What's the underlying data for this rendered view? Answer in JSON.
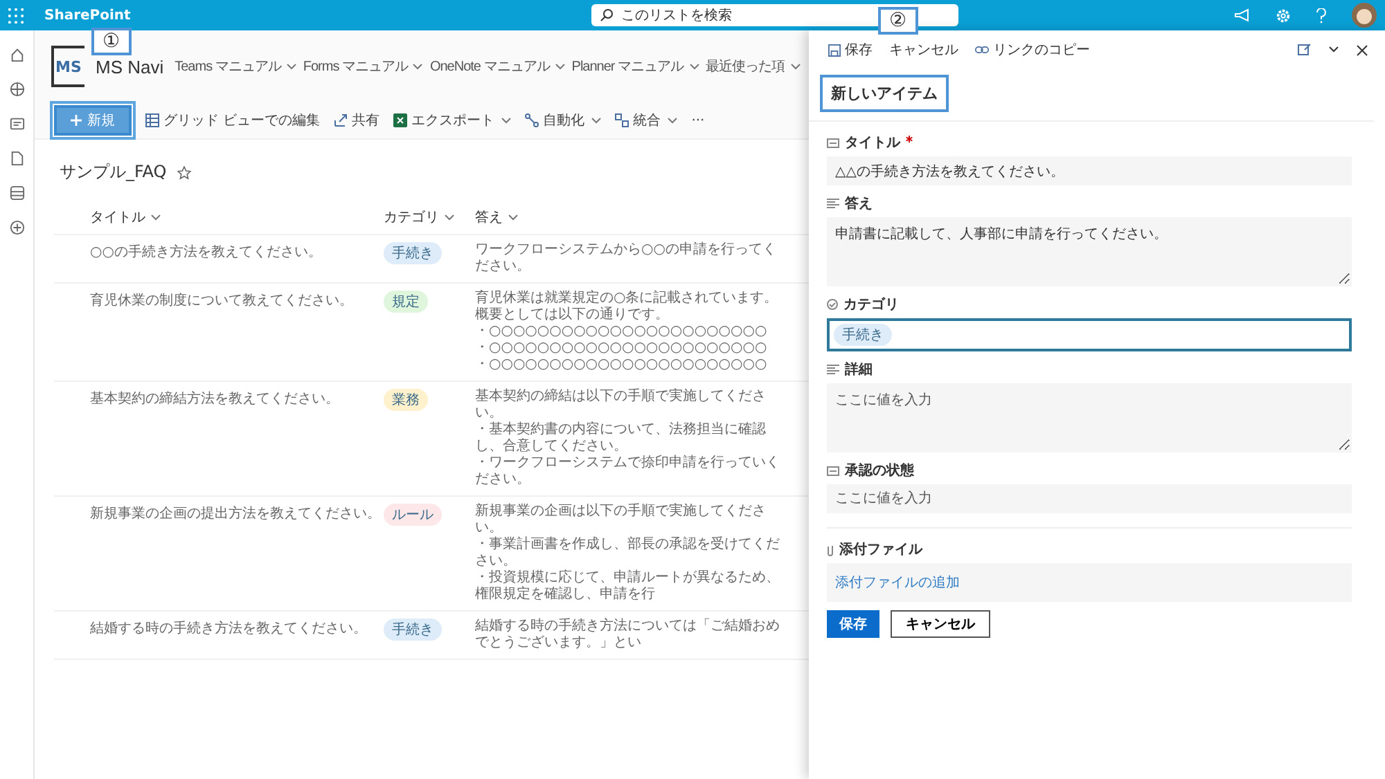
{
  "top_bar": {
    "app_name": "SharePoint",
    "search": {
      "placeholder": "このリストを検索"
    }
  },
  "site": {
    "logo_text": "MS",
    "name": "MS Navi",
    "nav": [
      "Teams マニュアル",
      "Forms マニュアル",
      "OneNote マニュアル",
      "Planner マニュアル",
      "最近使った項"
    ]
  },
  "command_bar": {
    "new_button": "新規",
    "items": [
      {
        "label": "グリッド ビューでの編集",
        "kind": "grid",
        "dropdown": false
      },
      {
        "label": "共有",
        "kind": "share",
        "dropdown": false
      },
      {
        "label": "エクスポート",
        "kind": "excel",
        "dropdown": true
      },
      {
        "label": "自動化",
        "kind": "flow",
        "dropdown": true
      },
      {
        "label": "統合",
        "kind": "integrate",
        "dropdown": true
      }
    ],
    "more": "···"
  },
  "list": {
    "title": "サンプル_FAQ",
    "favorite": false,
    "columns": [
      "タイトル",
      "カテゴリ",
      "答え"
    ],
    "rows": [
      {
        "title": "○○の手続き方法を教えてください。",
        "category": {
          "label": "手続き",
          "color": "#deecf9"
        },
        "answer": [
          "ワークフローシステムから○○の申請を行ってください。"
        ]
      },
      {
        "title": "育児休業の制度について教えてください。",
        "category": {
          "label": "規定",
          "color": "#dff6dd"
        },
        "answer": [
          "育児休業は就業規定の○条に記載されています。",
          "概要としては以下の通りです。",
          "・○○○○○○○○○○○○○○○○○○○○○○○",
          "・○○○○○○○○○○○○○○○○○○○○○○○",
          "・○○○○○○○○○○○○○○○○○○○○○○○"
        ]
      },
      {
        "title": "基本契約の締結方法を教えてください。",
        "category": {
          "label": "業務",
          "color": "#fff1cc"
        },
        "answer": [
          "基本契約の締結は以下の手順で実施してください。",
          "・基本契約書の内容について、法務担当に確認し、合意してください。",
          "・ワークフローシステムで捺印申請を行っていください。"
        ]
      },
      {
        "title": "新規事業の企画の提出方法を教えてください。",
        "category": {
          "label": "ルール",
          "color": "#fde7e9"
        },
        "answer": [
          "新規事業の企画は以下の手順で実施してください。",
          "・事業計画書を作成し、部長の承認を受けてください。",
          "・投資規模に応じて、申請ルートが異なるため、権限規定を確認し、申請を行"
        ]
      },
      {
        "title": "結婚する時の手続き方法を教えてください。",
        "category": {
          "label": "手続き",
          "color": "#deecf9"
        },
        "answer": [
          "結婚する時の手続き方法については「ご結婚おめでとうございます。」とい"
        ]
      }
    ]
  },
  "panel": {
    "toolbar": {
      "save": "保存",
      "cancel": "キャンセル",
      "copy_link": "リンクのコピー"
    },
    "title": "新しいアイテム",
    "fields": [
      {
        "kind": "text",
        "label": "タイトル",
        "required": true,
        "value": "△△の手続き方法を教えてください。"
      },
      {
        "kind": "multiline",
        "label": "答え",
        "required": false,
        "value": "申請書に記載して、人事部に申請を行ってください。"
      },
      {
        "kind": "choice",
        "label": "カテゴリ",
        "required": false,
        "value": "手続き",
        "focused": true
      },
      {
        "kind": "multiline",
        "label": "詳細",
        "required": false,
        "placeholder": "ここに値を入力"
      },
      {
        "kind": "text",
        "label": "承認の状態",
        "required": false,
        "placeholder": "ここに値を入力"
      },
      {
        "kind": "attachment",
        "label": "添付ファイル",
        "required": false,
        "link": "添付ファイルの追加"
      }
    ],
    "save_button": "保存",
    "cancel_button": "キャンセル"
  },
  "callouts": [
    "①",
    "②"
  ]
}
